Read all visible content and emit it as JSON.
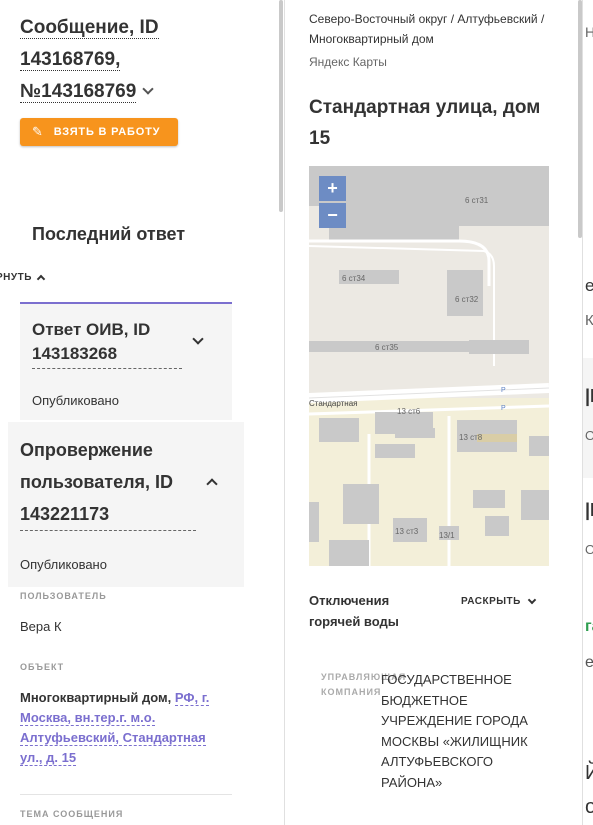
{
  "left": {
    "message_title_prefix": "Сообщение, ID",
    "message_id": "143168769,",
    "message_number": "№143168769",
    "take_button_label": "ВЗЯТЬ В РАБОТУ",
    "last_answer_heading": "Последний ответ",
    "collapse_label": "РНУТЬ",
    "oiv_card": {
      "title": "Ответ ОИВ, ID 143183268",
      "status": "Опубликовано"
    },
    "refute_card": {
      "title": "Опровержение пользователя, ID 143221173",
      "status": "Опубликовано"
    },
    "user_label": "ПОЛЬЗОВАТЕЛЬ",
    "user_value": "Вера К",
    "object_label": "ОБЪЕКТ",
    "object_bold": "Многоквартирный дом,",
    "object_link": "РФ, г. Москва, вн.тер.г. м.о. Алтуфьевский, Стандартная ул., д. 15",
    "subject_label": "ТЕМА СООБЩЕНИЯ"
  },
  "middle": {
    "breadcrumb": "Северо-Восточный округ / Алтуфьевский / Многоквартирный дом",
    "yandex_label": "Яндекс Карты",
    "street_title": "Стандартная улица, дом 15",
    "map": {
      "zoom_in": "+",
      "zoom_out": "−",
      "labels": [
        "6 ст31",
        "6 ст34",
        "6 ст32",
        "6 ст35",
        "Стандартная",
        "13 ст6",
        "13 ст8",
        "13 ст3",
        "13/1",
        "Р",
        "Р"
      ],
      "colors": {
        "building": "#c9c9c9",
        "ground": "#ece9e3",
        "residential": "#f3efd9",
        "road": "#ffffff"
      }
    },
    "outage_title": "Отключения горячей воды",
    "expand_label": "РАСКРЫТЬ",
    "management_label": "УПРАВЛЯЮЩАЯ КОМПАНИЯ",
    "management_value": "ГОСУДАРСТВЕННОЕ БЮДЖЕТНОЕ УЧРЕЖДЕНИЕ ГОРОДА МОСКВЫ «ЖИЛИЩНИК АЛТУФЬЕВСКОГО РАЙОНА»"
  },
  "right": {
    "fragments": [
      "Н",
      "е",
      "Ка",
      "|К",
      "ОЕ",
      "|К",
      "ОЕ",
      "га",
      "ер",
      "Й",
      "ох"
    ]
  },
  "colors": {
    "accent_orange": "#f7941d",
    "accent_purple": "#7b6fcf",
    "zoom_blue": "#6d8cc4",
    "green_fragment": "#2e9e4f"
  }
}
